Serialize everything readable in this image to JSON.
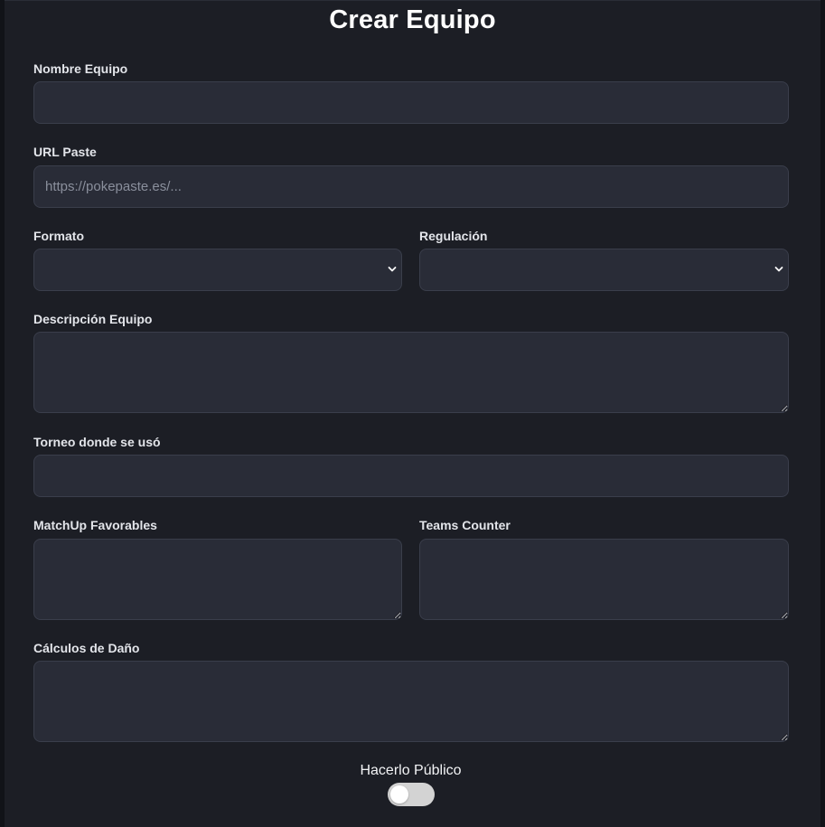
{
  "form": {
    "title": "Crear Equipo",
    "nombre_equipo": {
      "label": "Nombre Equipo",
      "value": ""
    },
    "url_paste": {
      "label": "URL Paste",
      "placeholder": "https://pokepaste.es/...",
      "value": ""
    },
    "formato": {
      "label": "Formato",
      "selected": ""
    },
    "regulacion": {
      "label": "Regulación",
      "selected": ""
    },
    "descripcion": {
      "label": "Descripción Equipo",
      "value": ""
    },
    "torneo": {
      "label": "Torneo donde se usó",
      "value": ""
    },
    "matchup": {
      "label": "MatchUp Favorables",
      "value": ""
    },
    "teams_counter": {
      "label": "Teams Counter",
      "value": ""
    },
    "calculos": {
      "label": "Cálculos de Daño",
      "value": ""
    },
    "publico": {
      "label": "Hacerlo Público",
      "enabled": false
    }
  },
  "icons": {
    "select_arrow": "chevron-down-icon",
    "resize_handle": "resize-grip-icon"
  },
  "colors": {
    "page_bg": "#111318",
    "panel_bg": "#1c1e25",
    "field_bg": "#292c37",
    "field_border": "#3a3e4b",
    "label_text": "#e3e5ea",
    "toggle_off": "#d3d3d3"
  }
}
